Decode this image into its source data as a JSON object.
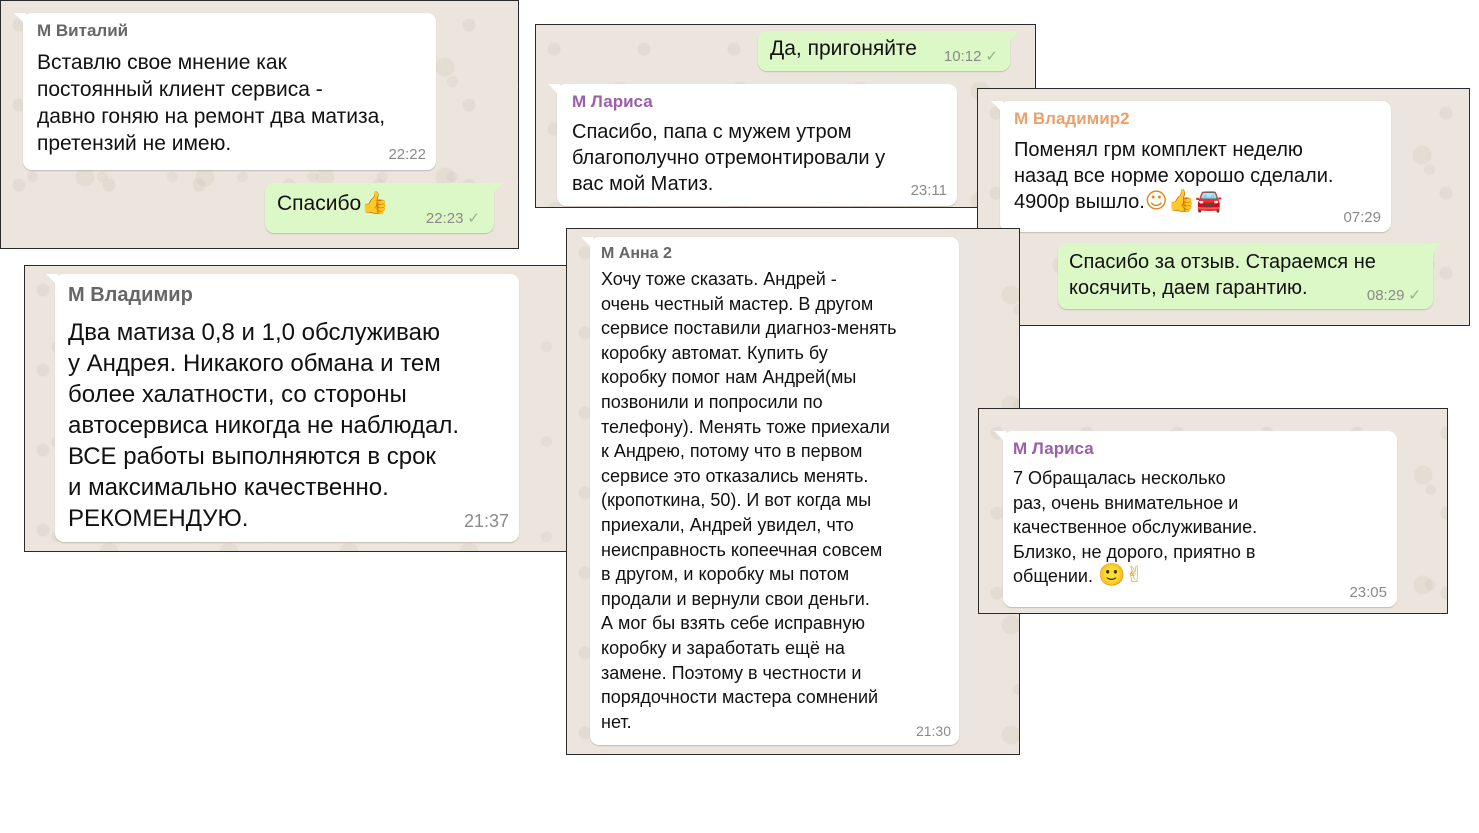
{
  "colors": {
    "chat_background": "#ece5dd",
    "incoming_bubble": "#ffffff",
    "outgoing_bubble": "#dcf8c6",
    "sender_gray": "#666666",
    "sender_purple": "#9a5fa8",
    "sender_orange": "#e9a26c",
    "timestamp": "#8a8a8a"
  },
  "shots": {
    "vitaliy": {
      "sender": "М Виталий",
      "message": "Вставлю свое мнение как\nпостоянный клиент сервиса -\nдавно гоняю на ремонт два матиза,\nпретензий не имею.",
      "time": "22:22",
      "reply": "Спасибо",
      "reply_emoji": "👍",
      "reply_time": "22:23",
      "reply_check": "✓"
    },
    "larisa1": {
      "out_message": "Да, пригоняйте",
      "out_time": "10:12",
      "out_check": "✓",
      "sender": "М Лариса",
      "message": "Спасибо, папа с мужем утром\nблагополучно отремонтировали у\nвас мой Матиз.",
      "time": "23:11"
    },
    "vladimir2": {
      "sender": "М Владимир2",
      "message": "Поменял грм комплект неделю\nназад все норме хорошо сделали.\n4900р вышло.",
      "emojis": "☺👍🚘",
      "time": "07:29",
      "reply": "Спасибо за отзыв. Стараемся не\nкосячить, даем гарантию.",
      "reply_time": "08:29",
      "reply_check": "✓"
    },
    "vladimir": {
      "sender": "М Владимир",
      "message": "Два матиза 0,8 и 1,0 обслуживаю\nу Андрея. Никакого обмана и тем\nболее халатности, со стороны\nавтосервиса никогда не наблюдал.\nВСЕ работы выполняются в срок\nи максимально качественно.\nРЕКОМЕНДУЮ.",
      "time": "21:37"
    },
    "anna2": {
      "sender": "М Анна 2",
      "message": "Хочу тоже сказать. Андрей -\nочень честный мастер. В другом\nсервисе поставили диагноз-менять\nкоробку автомат. Купить бу\nкоробку помог нам Андрей(мы\nпозвонили и попросили по\nтелефону). Менять тоже приехали\nк Андрею, потому что в первом\nсервисе это отказались менять.\n(кропоткина, 50). И вот когда мы\nприехали, Андрей увидел, что\nнеисправность копеечная совсем\nв другом, и коробку мы потом\nпродали и вернули свои деньги.\nА мог бы взять себе исправную\nкоробку и заработать ещё на\nзамене. Поэтому в честности и\nпорядочности мастера сомнений\nнет.",
      "time": "21:30"
    },
    "larisa2": {
      "sender": "М Лариса",
      "message": "7 Обращалась несколько\nраз, очень внимательное и\nкачественное обслуживание.\nБлизко, не дорого, приятно в\nобщении.",
      "emojis": "🙂✌",
      "time": "23:05"
    }
  }
}
